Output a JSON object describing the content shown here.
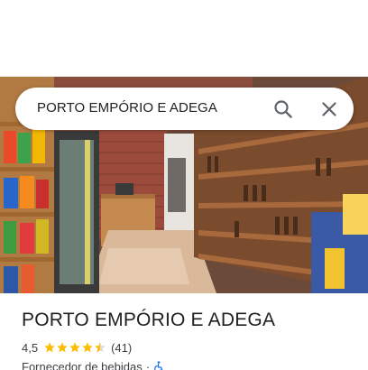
{
  "search": {
    "query": "PORTO EMPÓRIO E ADEGA",
    "search_icon": "search-icon",
    "close_icon": "close-icon"
  },
  "hero": {
    "description_icon": "storefront-photo"
  },
  "place": {
    "title": "PORTO EMPÓRIO E ADEGA",
    "rating": "4,5",
    "stars": 4.5,
    "review_count": "(41)",
    "category": "Fornecedor de bebidas",
    "separator": "·",
    "accessibility_icon": "wheelchair-icon"
  },
  "colors": {
    "star": "#fbbc04",
    "accessibility": "#1a73e8",
    "text_primary": "#202124",
    "text_secondary": "#3c4043"
  }
}
